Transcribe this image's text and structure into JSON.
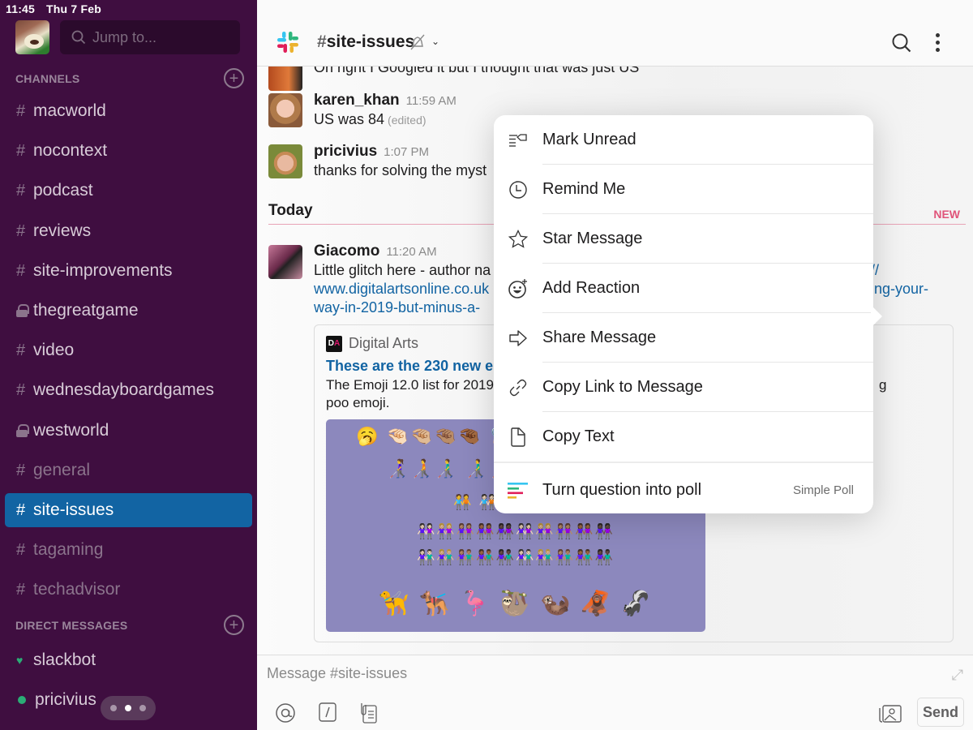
{
  "status_bar": {
    "time": "11:45",
    "date": "Thu 7 Feb"
  },
  "sidebar": {
    "search_placeholder": "Jump to...",
    "channels_header": "CHANNELS",
    "channels": [
      {
        "name": "macworld",
        "prefix": "#",
        "private": false,
        "state": "normal"
      },
      {
        "name": "nocontext",
        "prefix": "#",
        "private": false,
        "state": "normal"
      },
      {
        "name": "podcast",
        "prefix": "#",
        "private": false,
        "state": "normal"
      },
      {
        "name": "reviews",
        "prefix": "#",
        "private": false,
        "state": "normal"
      },
      {
        "name": "site-improvements",
        "prefix": "#",
        "private": false,
        "state": "normal"
      },
      {
        "name": "thegreatgame",
        "prefix": "lock",
        "private": true,
        "state": "normal"
      },
      {
        "name": "video",
        "prefix": "#",
        "private": false,
        "state": "normal"
      },
      {
        "name": "wednesdayboardgames",
        "prefix": "#",
        "private": false,
        "state": "normal"
      },
      {
        "name": "westworld",
        "prefix": "lock",
        "private": true,
        "state": "normal"
      },
      {
        "name": "general",
        "prefix": "#",
        "private": false,
        "state": "muted"
      },
      {
        "name": "site-issues",
        "prefix": "#",
        "private": false,
        "state": "active"
      },
      {
        "name": "tagaming",
        "prefix": "#",
        "private": false,
        "state": "muted"
      },
      {
        "name": "techadvisor",
        "prefix": "#",
        "private": false,
        "state": "muted"
      }
    ],
    "dm_header": "DIRECT MESSAGES",
    "dms": [
      {
        "name": "slackbot",
        "status": "heart"
      },
      {
        "name": "pricivius",
        "status": "online"
      }
    ],
    "hash": "#"
  },
  "header": {
    "channel_prefix": "#",
    "channel_name": "site-issues"
  },
  "messages": {
    "partial_top": "Oh right I Googled it but I thought that was just US",
    "items": [
      {
        "user": "karen_khan",
        "time": "11:59 AM",
        "text": "US was 84",
        "edited": "(edited)"
      },
      {
        "user": "pricivius",
        "time": "1:07 PM",
        "text": "thanks for solving the myst"
      }
    ],
    "divider_label": "Today",
    "new_label": "NEW",
    "giacomo": {
      "user": "Giacomo",
      "time": "11:20 AM",
      "line1_left": "Little glitch here - author na",
      "line1_right": "://",
      "line2_left": "www.digitalartsonline.co.uk",
      "line2_right": "ing-your-",
      "line3_left": "way-in-2019-but-minus-a-"
    },
    "embed": {
      "source": "Digital Arts",
      "logo_text": "DA",
      "title": "These are the 230 new emo",
      "desc_line1": "The Emoji 12.0 list for 2019",
      "desc_line1_right": "g",
      "desc_line2": "poo emoji.",
      "emoji_rows": [
        "🥱 🤏🏻🤏🏼🤏🏽🤏🏾 🦻🏻🦻🏼 🦾 🦿 👩‍🦽👩🏻‍🦽👩🏼‍🦽",
        "👩‍🦯🧑‍🦯👨‍🦯 👨‍🦯🧑‍🦯 🧍‍♀️🧍🧍‍♂️ 🧎‍♀️🧎",
        "🧑‍🤝‍🧑 🧑🏻‍🤝‍🧑🏻🧑🏼‍🤝‍🧑🏼🧑🏽‍🤝‍🧑🏽🧑🏾‍🤝‍🧑🏾🧑🏿‍🤝‍🧑🏿",
        "👭🏻👭🏼👭🏽👭🏾👭🏿👭🏻👭🏼👭🏽👭🏾👭🏿",
        "👫🏻👫🏼👫🏽👫🏾👫🏿👫🏻👫🏼👫🏽👫🏾👫🏿",
        "🦮 🐕‍🦺 🦩 🦥 🦦 🦧 🦨"
      ]
    }
  },
  "composer": {
    "placeholder": "Message #site-issues",
    "send_label": "Send"
  },
  "context_menu": {
    "items": [
      {
        "label": "Mark Unread",
        "icon": "mark-unread-icon"
      },
      {
        "label": "Remind Me",
        "icon": "clock-icon"
      },
      {
        "label": "Star Message",
        "icon": "star-icon"
      },
      {
        "label": "Add Reaction",
        "icon": "add-reaction-icon"
      },
      {
        "label": "Share Message",
        "icon": "share-arrow-icon"
      },
      {
        "label": "Copy Link to Message",
        "icon": "link-icon"
      },
      {
        "label": "Copy Text",
        "icon": "document-icon"
      }
    ],
    "app_action": {
      "label": "Turn question into poll",
      "app": "Simple Poll",
      "icon": "poll-icon"
    }
  },
  "colors": {
    "sidebar_bg": "#3f0e40",
    "active_channel": "#1264a3",
    "link": "#1264a3",
    "new_badge": "#e0557a",
    "presence": "#2bac76"
  }
}
